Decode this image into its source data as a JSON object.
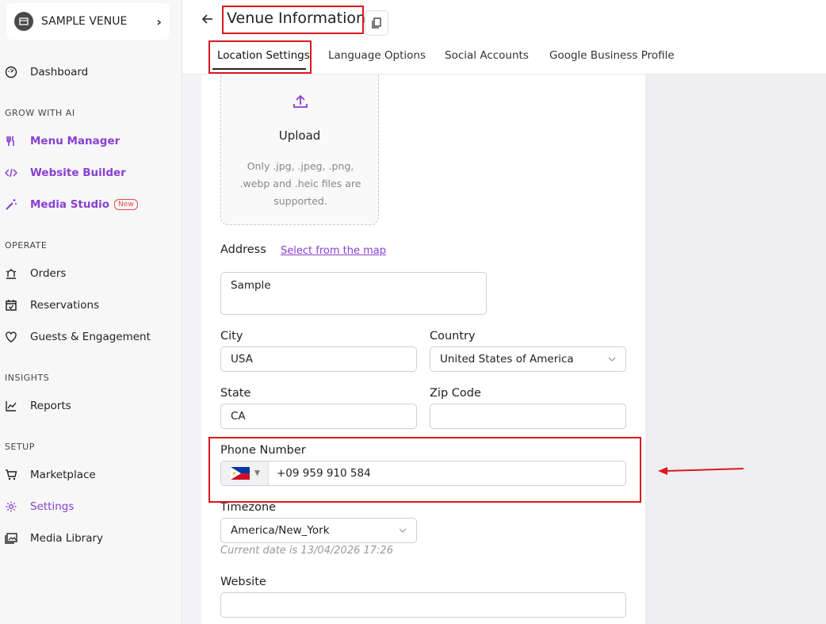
{
  "venue": {
    "name": "SAMPLE VENUE"
  },
  "sidebar": {
    "dashboard": "Dashboard",
    "sections": {
      "grow": "GROW WITH AI",
      "operate": "OPERATE",
      "insights": "INSIGHTS",
      "setup": "SETUP"
    },
    "items": {
      "menu_manager": "Menu Manager",
      "website_builder": "Website Builder",
      "media_studio": "Media Studio",
      "media_studio_badge": "New",
      "orders": "Orders",
      "reservations": "Reservations",
      "guests": "Guests & Engagement",
      "reports": "Reports",
      "marketplace": "Marketplace",
      "settings": "Settings",
      "media_library": "Media Library"
    }
  },
  "header": {
    "title": "Venue Information",
    "tabs": [
      "Location Settings",
      "Language Options",
      "Social Accounts",
      "Google Business Profile"
    ],
    "active_tab": "Location Settings"
  },
  "upload": {
    "title": "Upload",
    "hint": "Only .jpg, .jpeg, .png, .webp and .heic files are supported."
  },
  "form": {
    "address_label": "Address",
    "address_link": "Select from the map",
    "address_value": "Sample",
    "city_label": "City",
    "city_value": "USA",
    "country_label": "Country",
    "country_value": "United States of America",
    "state_label": "State",
    "state_value": "CA",
    "zip_label": "Zip Code",
    "zip_value": "",
    "phone_label": "Phone Number",
    "phone_value": "+09 959 910 584",
    "timezone_label": "Timezone",
    "timezone_value": "America/New_York",
    "timezone_hint": "Current date is 13/04/2026 17:26",
    "website_label": "Website",
    "website_value": ""
  },
  "colors": {
    "accent": "#8a3fd1",
    "highlight": "#d9191e"
  }
}
